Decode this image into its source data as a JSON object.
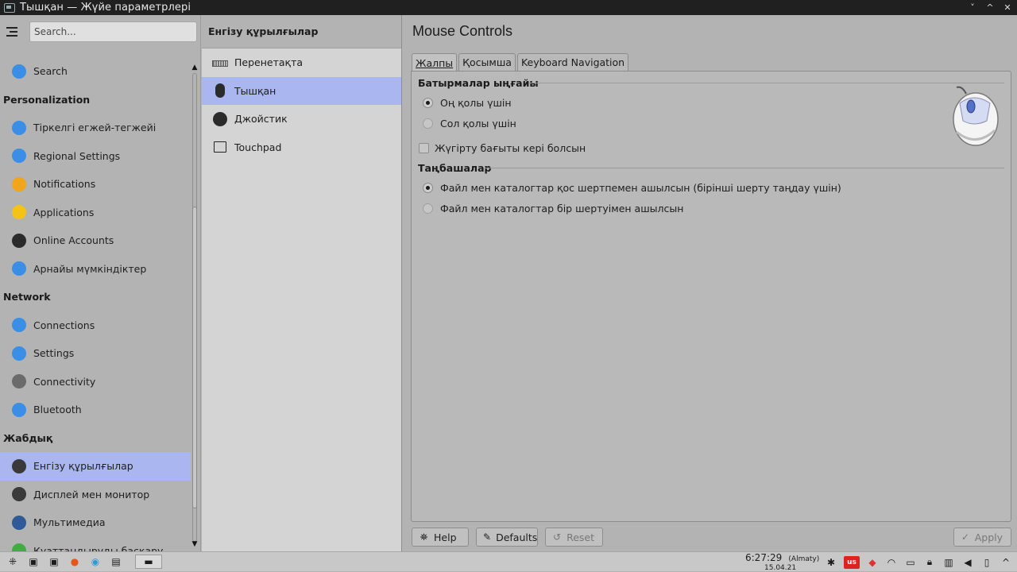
{
  "window": {
    "title": "Тышқан — Жүйе параметрлері",
    "controls": [
      "˅",
      "^",
      "✕"
    ]
  },
  "sidebar": {
    "search_placeholder": "Search...",
    "entries": [
      {
        "kind": "item",
        "label": "Search",
        "icon": "search-app-icon",
        "color": "#3a8ee6"
      },
      {
        "kind": "category",
        "label": "Personalization"
      },
      {
        "kind": "item",
        "label": "Тіркелгі егжей-тегжейі",
        "icon": "user-account-icon",
        "color": "#3a8ee6"
      },
      {
        "kind": "item",
        "label": "Regional Settings",
        "icon": "regional-settings-icon",
        "color": "#3a8ee6"
      },
      {
        "kind": "item",
        "label": "Notifications",
        "icon": "notifications-icon",
        "color": "#f2a51b"
      },
      {
        "kind": "item",
        "label": "Applications",
        "icon": "applications-star-icon",
        "color": "#f5c218"
      },
      {
        "kind": "item",
        "label": "Online Accounts",
        "icon": "online-accounts-globe-icon",
        "color": "#2a2a2a"
      },
      {
        "kind": "item",
        "label": "Арнайы мүмкіндіктер",
        "icon": "accessibility-icon",
        "color": "#3a8ee6"
      },
      {
        "kind": "category",
        "label": "Network"
      },
      {
        "kind": "item",
        "label": "Connections",
        "icon": "connections-globe-icon",
        "color": "#3a8ee6"
      },
      {
        "kind": "item",
        "label": "Settings",
        "icon": "network-settings-globe-icon",
        "color": "#3a8ee6"
      },
      {
        "kind": "item",
        "label": "Connectivity",
        "icon": "connectivity-icon",
        "color": "#6b6b6b"
      },
      {
        "kind": "item",
        "label": "Bluetooth",
        "icon": "bluetooth-icon",
        "color": "#3a8ee6"
      },
      {
        "kind": "category",
        "label": "Жабдық"
      },
      {
        "kind": "item",
        "label": "Енгізу құрылғылар",
        "icon": "input-devices-icon",
        "color": "#3a3a3a",
        "active": true
      },
      {
        "kind": "item",
        "label": "Дисплей мен монитор",
        "icon": "display-monitor-icon",
        "color": "#3a3a3a"
      },
      {
        "kind": "item",
        "label": "Мультимедиа",
        "icon": "multimedia-icon",
        "color": "#2e5a9a"
      },
      {
        "kind": "item",
        "label": "Қуаттандыруды басқару",
        "icon": "power-management-icon",
        "color": "#3fae3f"
      }
    ]
  },
  "middle": {
    "header": "Енгізу құрылғылар",
    "items": [
      {
        "label": "Перенетақта",
        "icon": "keyboard-icon"
      },
      {
        "label": "Тышқан",
        "icon": "mouse-icon",
        "active": true
      },
      {
        "label": "Джойстик",
        "icon": "joystick-icon"
      },
      {
        "label": "Touchpad",
        "icon": "touchpad-icon"
      }
    ]
  },
  "content": {
    "title": "Mouse Controls",
    "tabs": [
      {
        "label": "Жалпы",
        "active": true
      },
      {
        "label": "Қосымша"
      },
      {
        "label": "Keyboard Navigation"
      }
    ],
    "button_order_title": "Батырмалар ыңғайы",
    "right_handed": "Оң қолы үшін",
    "left_handed": "Сол қолы үшін",
    "reverse_scroll": "Жүгірту бағыты кері болсын",
    "icons_title": "Таңбашалар",
    "double_click": "Файл мен каталогтар қос шертпемен ашылсын (бірінші шерту таңдау үшін)",
    "single_click": "Файл мен каталогтар бір шертуімен ашылсын",
    "selected_button_order": "right",
    "selected_click_mode": "double",
    "reverse_scroll_checked": false
  },
  "buttons": {
    "help": "Help",
    "defaults": "Defaults",
    "reset": "Reset",
    "apply": "Apply"
  },
  "taskbar": {
    "time": "6:27:29",
    "timezone": "(Almaty)",
    "date": "15.04.21",
    "layout": "us"
  }
}
